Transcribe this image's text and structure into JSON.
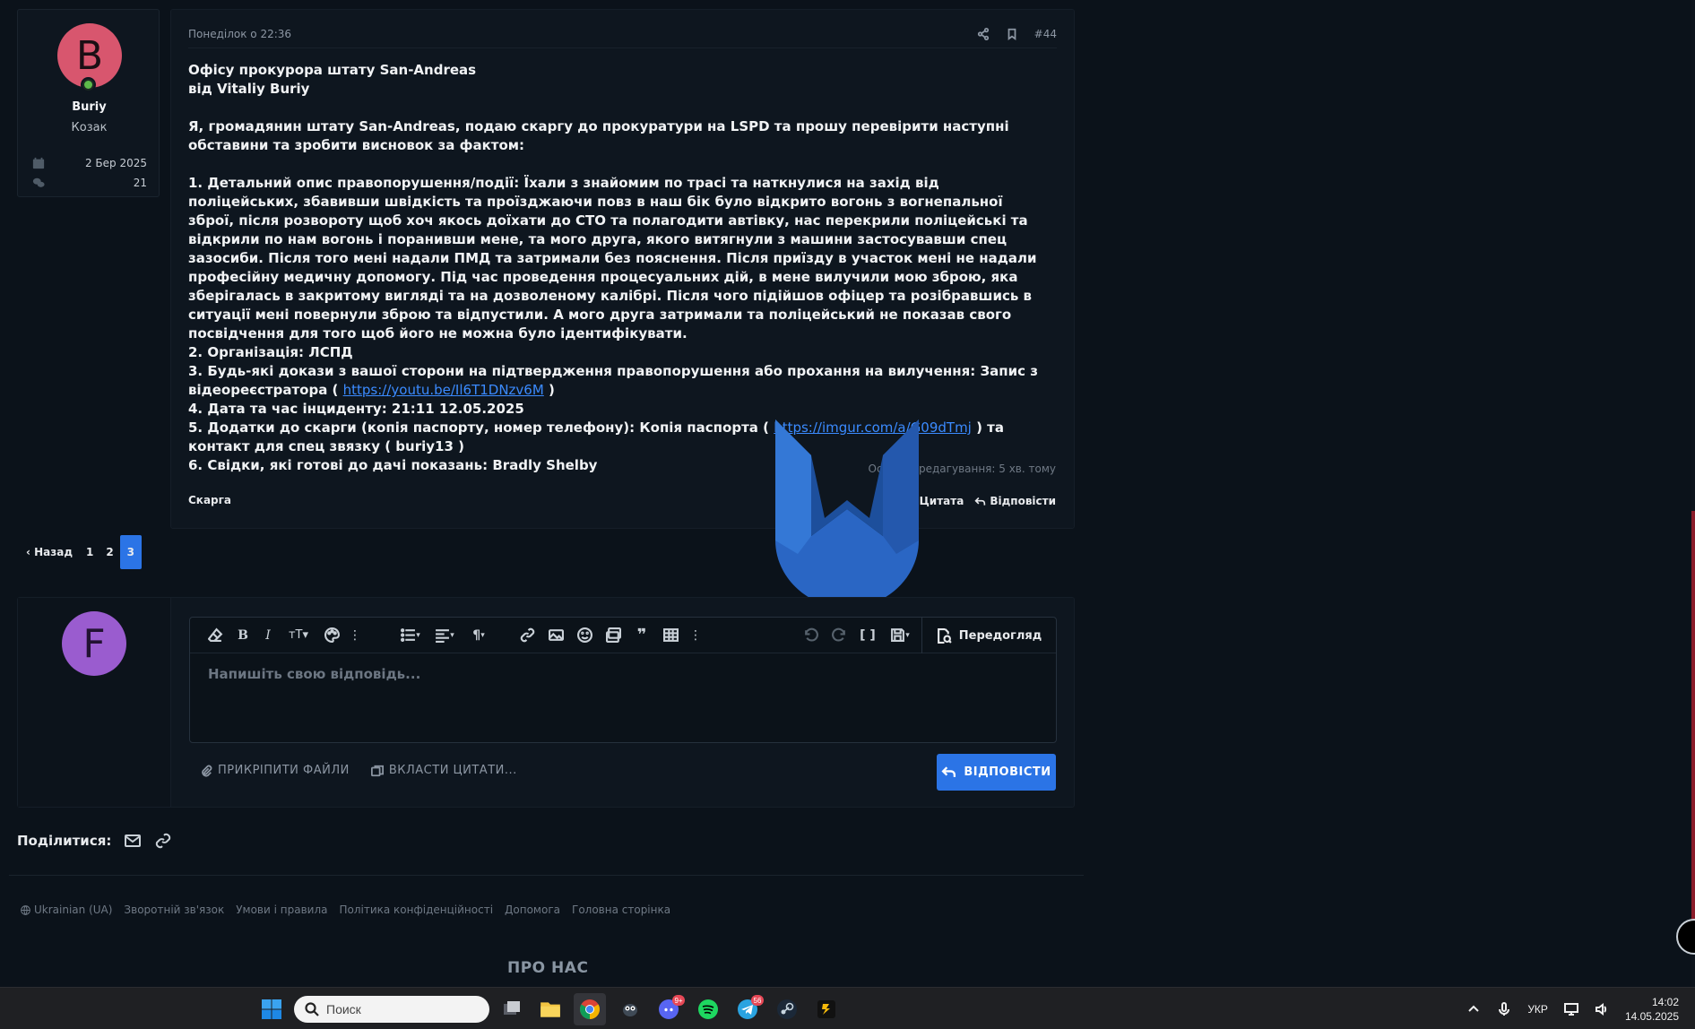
{
  "post": {
    "avatar_letter": "B",
    "username": "Buriy",
    "user_title": "Козак",
    "joined": "2 Бер 2025",
    "messages": "21",
    "date": "Понеділок о 22:36",
    "post_number": "#44",
    "lines": [
      "Офісу прокурора штату San-Andreas",
      "від Vitaliy Buriy",
      "",
      "Я, громадянин штату San-Andreas, подаю скаргу до прокуратури на LSPD та прошу перевірити наступні обставини та зробити висновок за фактом:",
      "",
      "1. Детальний опис правопорушення/події: Їхали з знайомим по трасі та наткнулися на захід від поліцейських, збавивши швідкість та проїзджаючи повз в наш бік було відкрито вогонь з вогнепальної зброї, після розвороту щоб хоч якось доїхати до СТО та полагодити автівку, нас перекрили поліцейські та відкрили по нам вогонь і поранивши мене, та мого друга, якого витягнули з машини застосувавши спец зазосиби. Після того мені надали ПМД та затримали без пояснення. Після приїзду в участок мені не надали професійну медичну допомогу. Під час проведення процесуальних дій, в мене вилучили мою зброю, яка зберігалась в закритому вигляді та на дозволеному калібрі. Після чого підійшов офіцер та розібравшись в ситуації мені повернули зброю та відпустили. А мого друга затримали та поліцейський не показав свого посвідчення для того щоб його не можна було ідентифікувати.",
      "2. Організація: ЛСПД"
    ],
    "line3_prefix": "3. Будь-які докази з вашої сторони на підтвердження правопорушення або прохання на вилучення: Запис з відеореєстратора ( ",
    "line3_link": "https://youtu.be/Il6T1DNzv6M",
    "line3_suffix": " )",
    "line4": "4. Дата та час інциденту: 21:11 12.05.2025",
    "line5_prefix": "5. Додатки до скарги (копія паспорту, номер телефону): Копія паспорта ( ",
    "line5_link": "https://imgur.com/a/G09dTmj",
    "line5_suffix": " ) та контакт для спец звязку ( buriy13 )",
    "line6": "6. Свідки, які готові до дачі показань: Bradly Shelby",
    "edited": "Останнє редагування: 5 хв. тому",
    "tag": "Скарга",
    "quote_label": "Цитата",
    "reply_label": "Відповісти"
  },
  "pagination": {
    "prev": "Назад",
    "pages": [
      "1",
      "2",
      "3"
    ],
    "current": "3"
  },
  "reply_box": {
    "avatar_letter": "F",
    "placeholder": "Напишіть свою відповідь...",
    "preview": "Передогляд",
    "attach_files": "ПРИКРІПИТИ ФАЙЛИ",
    "insert_quotes": "ВКЛАСТИ ЦИТАТИ...",
    "submit": "ВІДПОВІСТИ"
  },
  "share": {
    "label": "Поділитися:"
  },
  "footer": {
    "links": [
      "Ukrainian (UA)",
      "Зворотній зв'язок",
      "Умови і правила",
      "Політика конфіденційності",
      "Допомога",
      "Головна сторінка"
    ],
    "about": "ПРО НАС"
  },
  "taskbar": {
    "search_placeholder": "Поиск",
    "discord_badge": "9+",
    "telegram_badge": "56",
    "language": "УКР",
    "time": "14:02",
    "date": "14.05.2025"
  },
  "colors": {
    "accent": "#2b74e6",
    "avatar_b": "#d8566e",
    "avatar_f": "#9a5ccf",
    "link": "#3b8bff"
  }
}
